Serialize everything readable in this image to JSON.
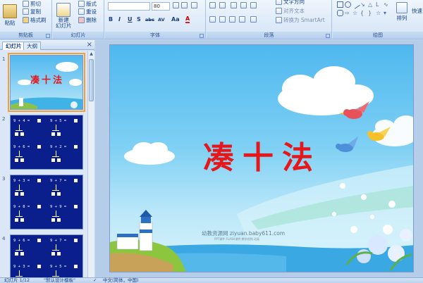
{
  "ribbon": {
    "clipboard": {
      "paste_label": "粘贴",
      "cut_label": "剪切",
      "copy_label": "复制",
      "format_painter_label": "格式刷",
      "group_label": "剪贴板"
    },
    "slides": {
      "new_slide_label": "新建\n幻灯片",
      "layout_label": "版式",
      "reset_label": "重设",
      "delete_label": "删除",
      "group_label": "幻灯片"
    },
    "font": {
      "font_name": "",
      "font_size": "80",
      "group_label": "字体",
      "format_buttons": [
        "B",
        "I",
        "U",
        "S",
        "abc",
        "AV",
        "Aa",
        "A"
      ]
    },
    "paragraph": {
      "text_direction_label": "文字方向",
      "align_text_label": "对齐文本",
      "smartart_label": "转换为 SmartArt",
      "group_label": "段落"
    },
    "drawing": {
      "arrange_label": "排列",
      "quick_styles_label": "快速",
      "group_label": "绘图"
    }
  },
  "pane": {
    "tabs": [
      "幻灯片",
      "大纲"
    ],
    "close_icon": "×",
    "slide_numbers": [
      "1",
      "2",
      "3",
      "4"
    ],
    "thumb_title": "凑十法",
    "equations": {
      "s2": [
        "9 + 4 =",
        "9 + 5 =",
        "9 + 6 =",
        "9 + 2 ="
      ],
      "s3": [
        "9 + 3 =",
        "9 + 7 =",
        "9 + 8 =",
        "9 + 9 ="
      ],
      "s4": [
        "9 + 6 =",
        "9 + 7 =",
        "9 + 3 =",
        "9 + 5 ="
      ]
    }
  },
  "slide": {
    "title": "凑十法",
    "watermark": "幼教资源网 ziyuan.baby611.com",
    "watermark_small": "PPT课件   FLASH课件   教学视频   动画"
  },
  "status": {
    "slide_counter": "幻灯片 1/12",
    "theme": "\"默认设计模板\"",
    "language": "中文(简体，中国)"
  },
  "colors": {
    "title_red": "#e5171b",
    "thumb_blue": "#0a1e8c",
    "selection_orange": "#f2a13a"
  }
}
